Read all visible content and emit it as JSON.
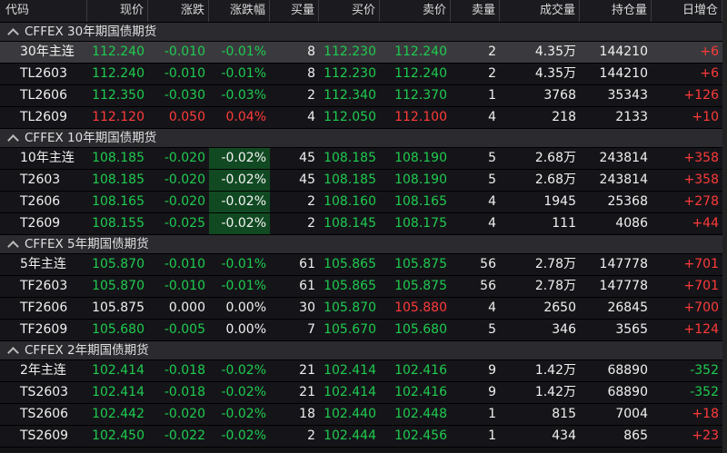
{
  "colors": {
    "up": "#ff3a3a",
    "down": "#1fcb4f",
    "flat": "#f0f0f0",
    "highlight": "#114a22"
  },
  "columns": [
    "代码",
    "现价",
    "涨跌",
    "涨跌幅",
    "买量",
    "买价",
    "卖价",
    "卖量",
    "成交量",
    "持仓量",
    "日增仓"
  ],
  "groups": [
    {
      "title": "CFFEX 30年期国债期货",
      "collapse_icon": "chevron-up-icon",
      "rows": [
        {
          "selected": true,
          "cells": [
            "30年主连",
            "112.240",
            "-0.010",
            "-0.01%",
            "8",
            "112.230",
            "112.240",
            "2",
            "4.35万",
            "144210",
            "+6"
          ],
          "colors": [
            "flat",
            "down",
            "down",
            "down",
            "flat",
            "down",
            "down",
            "flat",
            "flat",
            "flat",
            "up"
          ]
        },
        {
          "cells": [
            "TL2603",
            "112.240",
            "-0.010",
            "-0.01%",
            "8",
            "112.230",
            "112.240",
            "2",
            "4.35万",
            "144210",
            "+6"
          ],
          "colors": [
            "flat",
            "down",
            "down",
            "down",
            "flat",
            "down",
            "down",
            "flat",
            "flat",
            "flat",
            "up"
          ]
        },
        {
          "cells": [
            "TL2606",
            "112.350",
            "-0.030",
            "-0.03%",
            "2",
            "112.340",
            "112.370",
            "1",
            "3768",
            "35343",
            "+126"
          ],
          "colors": [
            "flat",
            "down",
            "down",
            "down",
            "flat",
            "down",
            "down",
            "flat",
            "flat",
            "flat",
            "up"
          ]
        },
        {
          "cells": [
            "TL2609",
            "112.120",
            "0.050",
            "0.04%",
            "4",
            "112.050",
            "112.100",
            "4",
            "218",
            "2133",
            "+10"
          ],
          "colors": [
            "flat",
            "up",
            "up",
            "up",
            "flat",
            "down",
            "up",
            "flat",
            "flat",
            "flat",
            "up"
          ]
        }
      ]
    },
    {
      "title": "CFFEX 10年期国债期货",
      "collapse_icon": "chevron-up-icon",
      "highlight_column": 3,
      "rows": [
        {
          "cells": [
            "10年主连",
            "108.185",
            "-0.020",
            "-0.02%",
            "45",
            "108.185",
            "108.190",
            "5",
            "2.68万",
            "243814",
            "+358"
          ],
          "colors": [
            "flat",
            "down",
            "down",
            "flat",
            "flat",
            "down",
            "down",
            "flat",
            "flat",
            "flat",
            "up"
          ]
        },
        {
          "cells": [
            "T2603",
            "108.185",
            "-0.020",
            "-0.02%",
            "45",
            "108.185",
            "108.190",
            "5",
            "2.68万",
            "243814",
            "+358"
          ],
          "colors": [
            "flat",
            "down",
            "down",
            "flat",
            "flat",
            "down",
            "down",
            "flat",
            "flat",
            "flat",
            "up"
          ]
        },
        {
          "cells": [
            "T2606",
            "108.165",
            "-0.020",
            "-0.02%",
            "2",
            "108.160",
            "108.165",
            "4",
            "1945",
            "25368",
            "+278"
          ],
          "colors": [
            "flat",
            "down",
            "down",
            "flat",
            "flat",
            "down",
            "down",
            "flat",
            "flat",
            "flat",
            "up"
          ]
        },
        {
          "cells": [
            "T2609",
            "108.155",
            "-0.025",
            "-0.02%",
            "2",
            "108.145",
            "108.175",
            "4",
            "111",
            "4086",
            "+44"
          ],
          "colors": [
            "flat",
            "down",
            "down",
            "flat",
            "flat",
            "down",
            "down",
            "flat",
            "flat",
            "flat",
            "up"
          ]
        }
      ]
    },
    {
      "title": "CFFEX 5年期国债期货",
      "collapse_icon": "chevron-up-icon",
      "rows": [
        {
          "cells": [
            "5年主连",
            "105.870",
            "-0.010",
            "-0.01%",
            "61",
            "105.865",
            "105.875",
            "56",
            "2.78万",
            "147778",
            "+701"
          ],
          "colors": [
            "flat",
            "down",
            "down",
            "down",
            "flat",
            "down",
            "down",
            "flat",
            "flat",
            "flat",
            "up"
          ]
        },
        {
          "cells": [
            "TF2603",
            "105.870",
            "-0.010",
            "-0.01%",
            "61",
            "105.865",
            "105.875",
            "56",
            "2.78万",
            "147778",
            "+701"
          ],
          "colors": [
            "flat",
            "down",
            "down",
            "down",
            "flat",
            "down",
            "down",
            "flat",
            "flat",
            "flat",
            "up"
          ]
        },
        {
          "cells": [
            "TF2606",
            "105.875",
            "0.000",
            "0.00%",
            "30",
            "105.870",
            "105.880",
            "4",
            "2650",
            "26845",
            "+700"
          ],
          "colors": [
            "flat",
            "flat",
            "flat",
            "flat",
            "flat",
            "down",
            "up",
            "flat",
            "flat",
            "flat",
            "up"
          ]
        },
        {
          "cells": [
            "TF2609",
            "105.680",
            "-0.005",
            "0.00%",
            "7",
            "105.670",
            "105.680",
            "5",
            "346",
            "3565",
            "+124"
          ],
          "colors": [
            "flat",
            "down",
            "down",
            "flat",
            "flat",
            "down",
            "down",
            "flat",
            "flat",
            "flat",
            "up"
          ]
        }
      ]
    },
    {
      "title": "CFFEX 2年期国债期货",
      "collapse_icon": "chevron-up-icon",
      "rows": [
        {
          "cells": [
            "2年主连",
            "102.414",
            "-0.018",
            "-0.02%",
            "21",
            "102.414",
            "102.416",
            "9",
            "1.42万",
            "68890",
            "-352"
          ],
          "colors": [
            "flat",
            "down",
            "down",
            "down",
            "flat",
            "down",
            "down",
            "flat",
            "flat",
            "flat",
            "down"
          ]
        },
        {
          "cells": [
            "TS2603",
            "102.414",
            "-0.018",
            "-0.02%",
            "21",
            "102.414",
            "102.416",
            "9",
            "1.42万",
            "68890",
            "-352"
          ],
          "colors": [
            "flat",
            "down",
            "down",
            "down",
            "flat",
            "down",
            "down",
            "flat",
            "flat",
            "flat",
            "down"
          ]
        },
        {
          "cells": [
            "TS2606",
            "102.442",
            "-0.020",
            "-0.02%",
            "18",
            "102.440",
            "102.448",
            "1",
            "815",
            "7004",
            "+18"
          ],
          "colors": [
            "flat",
            "down",
            "down",
            "down",
            "flat",
            "down",
            "down",
            "flat",
            "flat",
            "flat",
            "up"
          ]
        },
        {
          "cells": [
            "TS2609",
            "102.450",
            "-0.022",
            "-0.02%",
            "2",
            "102.444",
            "102.456",
            "1",
            "434",
            "865",
            "+23"
          ],
          "colors": [
            "flat",
            "down",
            "down",
            "down",
            "flat",
            "down",
            "down",
            "flat",
            "flat",
            "flat",
            "up"
          ]
        }
      ]
    }
  ]
}
